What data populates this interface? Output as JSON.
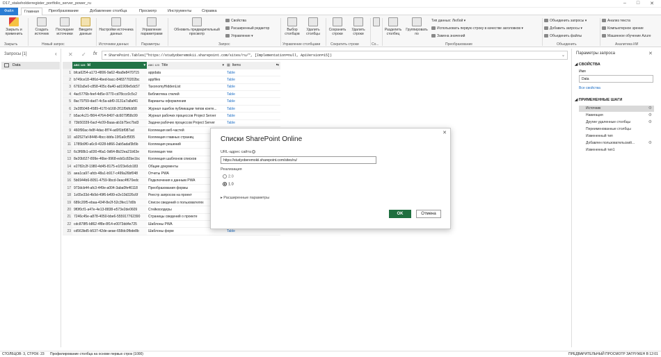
{
  "window": {
    "title": "D17_stakeholderregister_portfolio_server_power_ru"
  },
  "tabs": [
    {
      "label": "Файл",
      "kind": "file"
    },
    {
      "label": "Главная",
      "kind": "active"
    },
    {
      "label": "Преобразование",
      "kind": "normal"
    },
    {
      "label": "Добавление столбца",
      "kind": "normal"
    },
    {
      "label": "Просмотр",
      "kind": "normal"
    },
    {
      "label": "Инструменты",
      "kind": "normal"
    },
    {
      "label": "Справка",
      "kind": "normal"
    }
  ],
  "ribbon": {
    "close_apply": "Закрыть и применить",
    "new_source": "Создать источник",
    "recent_sources": "Последние источники",
    "enter_data": "Введите данные",
    "datasource_settings": "Настройки источника данных",
    "manage_params": "Управление параметрами",
    "refresh_preview": "Обновить предварительный просмотр",
    "properties": "Свойства",
    "advanced_editor": "Расширенный редактор",
    "manage": "Управление",
    "choose_columns": "Выбор столбцов",
    "remove_columns": "Удалить столбцы",
    "keep_rows": "Сохранить строки",
    "remove_rows": "Удалить строки",
    "split_column": "Разделить столбец",
    "group_by": "Группировать по",
    "data_type": "Тип данных: Любой",
    "first_row_headers": "Использовать первую строку в качестве заголовков",
    "replace_values": "Замена значений",
    "merge_queries": "Объединить запросы",
    "append_queries": "Добавить запросы",
    "combine_files": "Объединить файлы",
    "text_analytics": "Анализ текста",
    "vision": "Компьютерное зрение",
    "azure_ml": "Машинное обучение Azure",
    "groups": [
      "Закрыть",
      "Новый запрос",
      "Источники данных",
      "Параметры",
      "Запрос",
      "Управление столбцами",
      "Сократить строки",
      "Со...",
      "Преобразование",
      "Объединить",
      "Аналитика ИИ"
    ]
  },
  "left": {
    "header": "Запросы [1]",
    "query": "Data"
  },
  "formula": {
    "text": "= SharePoint.Tables(\"https://studyoberemokii.sharepoint.com/sites/ru/\", [Implementation=null, ApiVersion=15])"
  },
  "grid": {
    "headers": [
      "Id",
      "Title",
      "Items"
    ],
    "header_types": [
      "ABC 123",
      "ABC 123",
      ""
    ],
    "rows": [
      [
        "bfca6254-a173-4806-9a62-4ba8e8470715",
        "appdata",
        "Table"
      ],
      [
        "b749ce18-486d-4bed-bacc-8483770202bc",
        "appfiles",
        "Table"
      ],
      [
        "6792a5e0-c858-405c-8a40-ad1909e5dc57",
        "TaxonomyHiddenList",
        "Table"
      ],
      [
        "4ac5776b-feef-4d5e-9770-cd78ccc0c5c2",
        "Библиотека стилей",
        "Table"
      ],
      [
        "8ac79759-dad7-4c5a-abf0-3131a7a8af41",
        "Варианты оформления",
        "Table"
      ],
      [
        "2e285048-4589-4170-b168-2f11f9dfcb58",
        "Журнал ошибок публикации типов конте...",
        "Table"
      ],
      [
        "b5ac4c21-f904-4764-8497-dc6079f58c99",
        "Журнал рабочих процессов Project Server",
        "Table"
      ],
      [
        "73b50339-6acf-4c09-8aaa-ab1b75ec7bd3",
        "Задачи рабочих процессов Project Server",
        "Table"
      ],
      [
        "460f90ac-fe8f-4dac-8f74-ad0f1bf087ad",
        "Коллекция веб-частей",
        "Table"
      ],
      [
        "a02527af-8448-4bcc-bbfa-19f1a0cf5f35",
        "Коллекция главных страниц",
        "Table"
      ],
      [
        "1785b9f0-a6c9-4328-b866-2ab5adaf3b5b",
        "Коллекция решений",
        "Table"
      ],
      [
        "6c3f68b1-a030-46a1-9d64-8b22ea21b63e",
        "Коллекция тем",
        "Table"
      ],
      [
        "8e20b527-899e-46be-9968-edd1c82be1bc",
        "Коллекция шаблонов списков",
        "Table"
      ],
      [
        "e2782c2f-1980-4d45-8175-e1f23e6cb183",
        "Общие документы",
        "Table"
      ],
      [
        "aea1ca97-afcb-48a1-b917-c499a26bf048",
        "Отчеты PWA",
        "Table"
      ],
      [
        "5b6944b6-8051-4759-9bcd-0eac4f670edc",
        "Подключения к данным PWA",
        "Table"
      ],
      [
        "973dcb44-afc3-449e-a004-3aba0fe46118",
        "Преобразования формы",
        "Table"
      ],
      [
        "1c65e33d-4b9d-49f6-b499-e2e10d326c6f",
        "Реестр запросов на проект",
        "Table"
      ],
      [
        "689c20f5-ebaa-434f-8e2f-52c3fec17d0b",
        "Список сведений о пользователях",
        "Table"
      ],
      [
        "9f0f0cf1-a47e-4e13-8838-e573e2de0609",
        "Стейкхолдеры",
        "Table"
      ],
      [
        "7246c45e-a878-4050-bbe6-555917762390",
        "Страницы сведений о проекте",
        "Table"
      ],
      [
        "cdc878f5-b862-4f8e-8f14-e0073dd4e725",
        "Шаблоны PWA",
        "Table"
      ],
      [
        "cd563bd5-b537-42de-aeae-658dc0fbde8b",
        "Шаблоны форм",
        "Table"
      ]
    ]
  },
  "right": {
    "title": "Параметры запроса",
    "properties_label": "СВОЙСТВА",
    "name_label": "Имя",
    "name_value": "Data",
    "all_props": "Все свойства",
    "steps_label": "ПРИМЕНЕННЫЕ ШАГИ",
    "steps": [
      "Источник",
      "Навигация",
      "Другие удаленные столбцы",
      "Переименованные столбцы",
      "Измененный тип",
      "Добавлен пользовательский...",
      "Измененный тип1"
    ]
  },
  "dialog": {
    "title": "Списки SharePoint Online",
    "url_label": "URL-адрес сайта",
    "url_value": "https://studyoberemokii.sharepoint.com/sites/ru/",
    "impl_label": "Реализация",
    "opt1": "2.0",
    "opt2": "1.0",
    "advanced": "Расширенные параметры",
    "ok": "OK",
    "cancel": "Отмена"
  },
  "status": {
    "left": "СТОЛБЦОВ: 3, СТРОК: 23",
    "middle": "Профилирование столбца на основе первых строк (1000)",
    "right": "ПРЕДВАРИТЕЛЬНЫЙ ПРОСМОТР ЗАГРУЖЕН В 12:01"
  },
  "colors": {
    "accent": "#2b7cd3",
    "ok": "#1f6f3f",
    "header_sel": "#217346"
  }
}
